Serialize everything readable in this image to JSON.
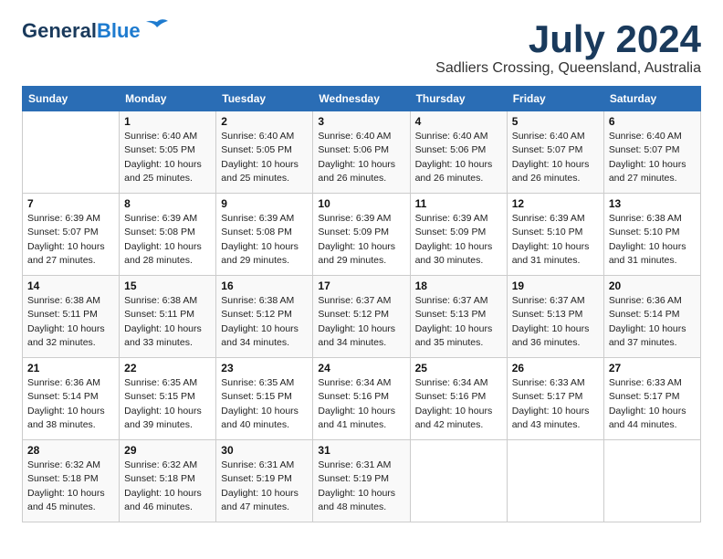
{
  "header": {
    "logo_general": "General",
    "logo_blue": "Blue",
    "month": "July 2024",
    "location": "Sadliers Crossing, Queensland, Australia"
  },
  "weekdays": [
    "Sunday",
    "Monday",
    "Tuesday",
    "Wednesday",
    "Thursday",
    "Friday",
    "Saturday"
  ],
  "weeks": [
    [
      {
        "day": "",
        "info": ""
      },
      {
        "day": "1",
        "info": "Sunrise: 6:40 AM\nSunset: 5:05 PM\nDaylight: 10 hours\nand 25 minutes."
      },
      {
        "day": "2",
        "info": "Sunrise: 6:40 AM\nSunset: 5:05 PM\nDaylight: 10 hours\nand 25 minutes."
      },
      {
        "day": "3",
        "info": "Sunrise: 6:40 AM\nSunset: 5:06 PM\nDaylight: 10 hours\nand 26 minutes."
      },
      {
        "day": "4",
        "info": "Sunrise: 6:40 AM\nSunset: 5:06 PM\nDaylight: 10 hours\nand 26 minutes."
      },
      {
        "day": "5",
        "info": "Sunrise: 6:40 AM\nSunset: 5:07 PM\nDaylight: 10 hours\nand 26 minutes."
      },
      {
        "day": "6",
        "info": "Sunrise: 6:40 AM\nSunset: 5:07 PM\nDaylight: 10 hours\nand 27 minutes."
      }
    ],
    [
      {
        "day": "7",
        "info": "Sunrise: 6:39 AM\nSunset: 5:07 PM\nDaylight: 10 hours\nand 27 minutes."
      },
      {
        "day": "8",
        "info": "Sunrise: 6:39 AM\nSunset: 5:08 PM\nDaylight: 10 hours\nand 28 minutes."
      },
      {
        "day": "9",
        "info": "Sunrise: 6:39 AM\nSunset: 5:08 PM\nDaylight: 10 hours\nand 29 minutes."
      },
      {
        "day": "10",
        "info": "Sunrise: 6:39 AM\nSunset: 5:09 PM\nDaylight: 10 hours\nand 29 minutes."
      },
      {
        "day": "11",
        "info": "Sunrise: 6:39 AM\nSunset: 5:09 PM\nDaylight: 10 hours\nand 30 minutes."
      },
      {
        "day": "12",
        "info": "Sunrise: 6:39 AM\nSunset: 5:10 PM\nDaylight: 10 hours\nand 31 minutes."
      },
      {
        "day": "13",
        "info": "Sunrise: 6:38 AM\nSunset: 5:10 PM\nDaylight: 10 hours\nand 31 minutes."
      }
    ],
    [
      {
        "day": "14",
        "info": "Sunrise: 6:38 AM\nSunset: 5:11 PM\nDaylight: 10 hours\nand 32 minutes."
      },
      {
        "day": "15",
        "info": "Sunrise: 6:38 AM\nSunset: 5:11 PM\nDaylight: 10 hours\nand 33 minutes."
      },
      {
        "day": "16",
        "info": "Sunrise: 6:38 AM\nSunset: 5:12 PM\nDaylight: 10 hours\nand 34 minutes."
      },
      {
        "day": "17",
        "info": "Sunrise: 6:37 AM\nSunset: 5:12 PM\nDaylight: 10 hours\nand 34 minutes."
      },
      {
        "day": "18",
        "info": "Sunrise: 6:37 AM\nSunset: 5:13 PM\nDaylight: 10 hours\nand 35 minutes."
      },
      {
        "day": "19",
        "info": "Sunrise: 6:37 AM\nSunset: 5:13 PM\nDaylight: 10 hours\nand 36 minutes."
      },
      {
        "day": "20",
        "info": "Sunrise: 6:36 AM\nSunset: 5:14 PM\nDaylight: 10 hours\nand 37 minutes."
      }
    ],
    [
      {
        "day": "21",
        "info": "Sunrise: 6:36 AM\nSunset: 5:14 PM\nDaylight: 10 hours\nand 38 minutes."
      },
      {
        "day": "22",
        "info": "Sunrise: 6:35 AM\nSunset: 5:15 PM\nDaylight: 10 hours\nand 39 minutes."
      },
      {
        "day": "23",
        "info": "Sunrise: 6:35 AM\nSunset: 5:15 PM\nDaylight: 10 hours\nand 40 minutes."
      },
      {
        "day": "24",
        "info": "Sunrise: 6:34 AM\nSunset: 5:16 PM\nDaylight: 10 hours\nand 41 minutes."
      },
      {
        "day": "25",
        "info": "Sunrise: 6:34 AM\nSunset: 5:16 PM\nDaylight: 10 hours\nand 42 minutes."
      },
      {
        "day": "26",
        "info": "Sunrise: 6:33 AM\nSunset: 5:17 PM\nDaylight: 10 hours\nand 43 minutes."
      },
      {
        "day": "27",
        "info": "Sunrise: 6:33 AM\nSunset: 5:17 PM\nDaylight: 10 hours\nand 44 minutes."
      }
    ],
    [
      {
        "day": "28",
        "info": "Sunrise: 6:32 AM\nSunset: 5:18 PM\nDaylight: 10 hours\nand 45 minutes."
      },
      {
        "day": "29",
        "info": "Sunrise: 6:32 AM\nSunset: 5:18 PM\nDaylight: 10 hours\nand 46 minutes."
      },
      {
        "day": "30",
        "info": "Sunrise: 6:31 AM\nSunset: 5:19 PM\nDaylight: 10 hours\nand 47 minutes."
      },
      {
        "day": "31",
        "info": "Sunrise: 6:31 AM\nSunset: 5:19 PM\nDaylight: 10 hours\nand 48 minutes."
      },
      {
        "day": "",
        "info": ""
      },
      {
        "day": "",
        "info": ""
      },
      {
        "day": "",
        "info": ""
      }
    ]
  ]
}
